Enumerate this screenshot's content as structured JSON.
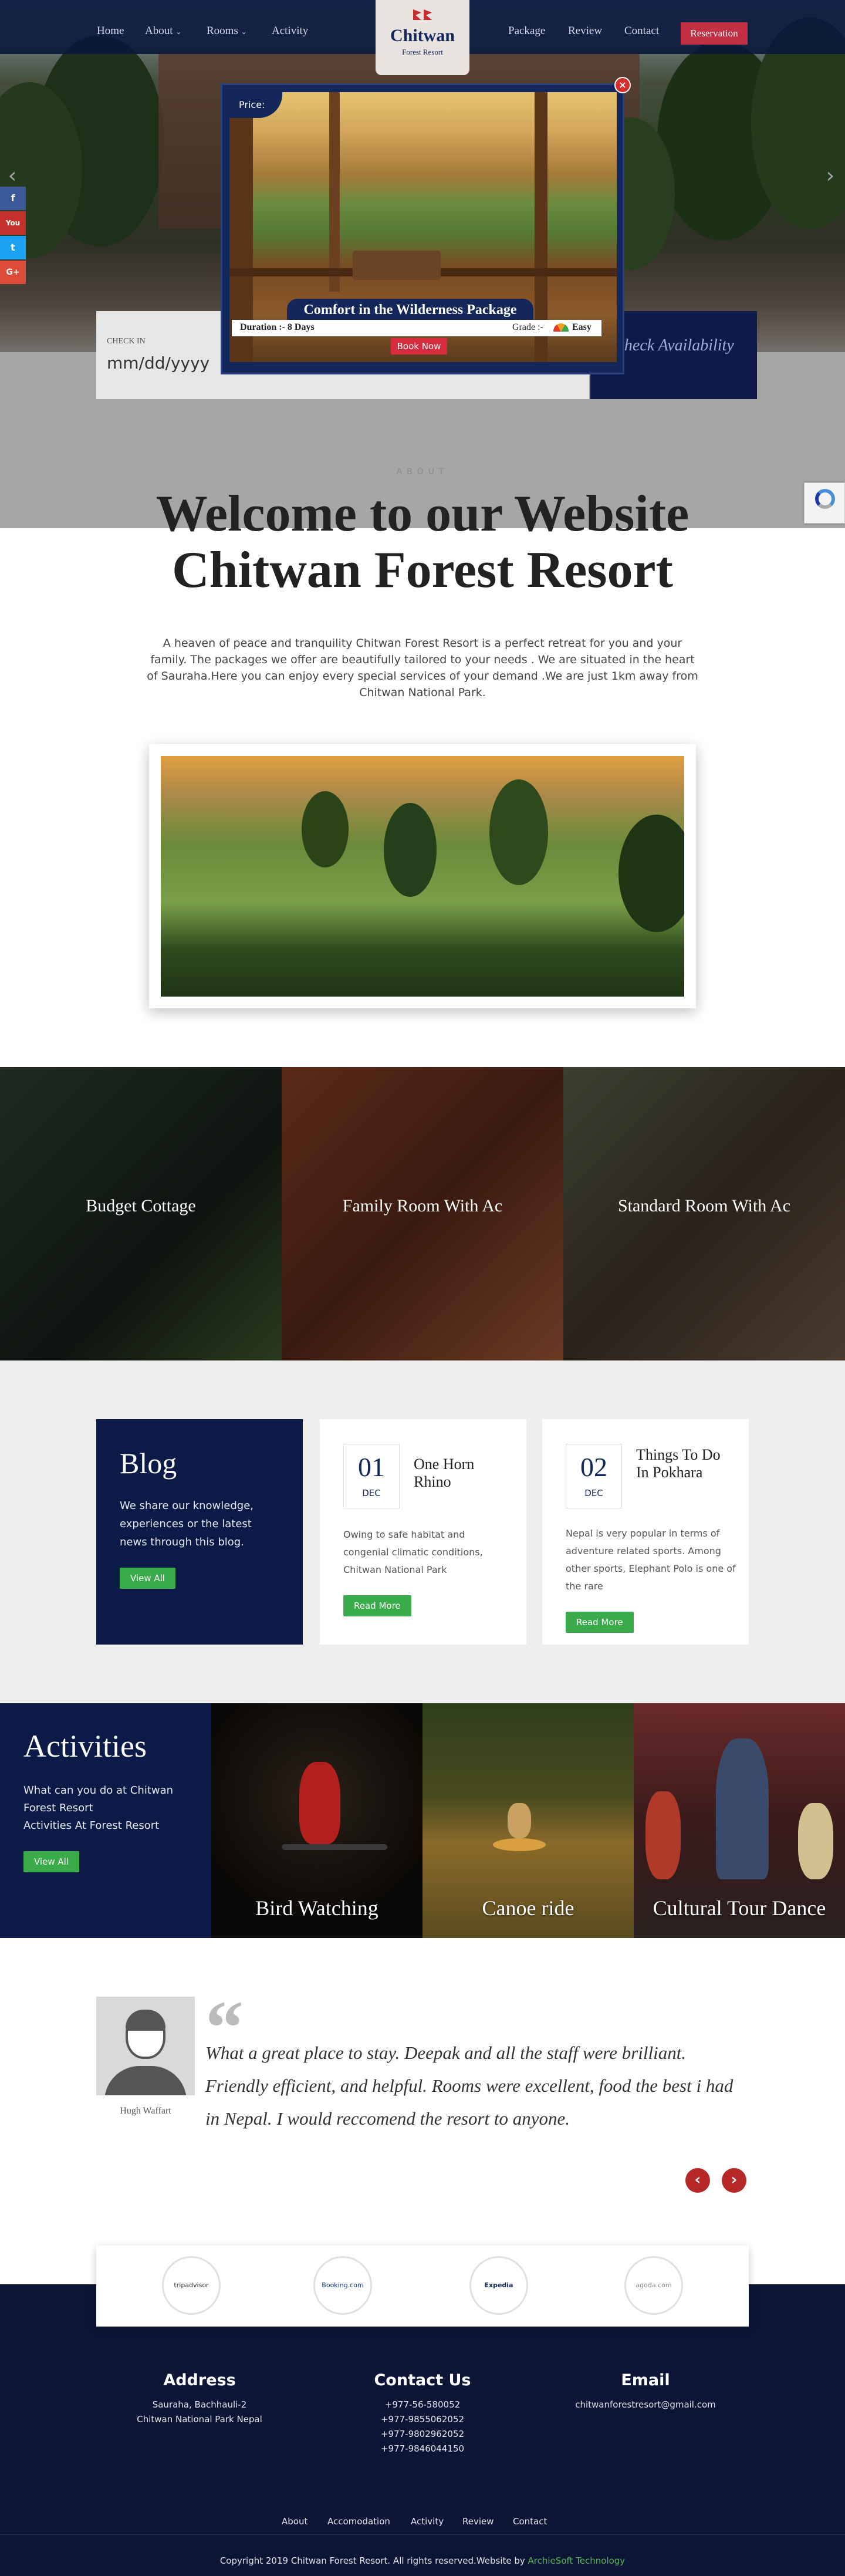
{
  "nav": {
    "left": [
      "Home",
      "About",
      "Rooms",
      "Activity"
    ],
    "right": [
      "Package",
      "Review",
      "Contact"
    ],
    "reservation": "Reservation"
  },
  "logo": {
    "title": "Chitwan",
    "subtitle": "Forest Resort"
  },
  "booking": {
    "check_in_label": "CHECK IN",
    "check_in_value": "mm/dd/yyyy",
    "check_button": "Check Availability"
  },
  "popup": {
    "price_label": "Price:",
    "title": "Comfort in the Wilderness Package",
    "duration": "Duration :- 8 Days",
    "grade": "Grade :-",
    "grade_value": "Easy",
    "book": "Book Now",
    "close": "×"
  },
  "about": {
    "kicker": "ABOUT",
    "title_line1": "Welcome to our Website",
    "title_line2": "Chitwan Forest Resort",
    "text": "A heaven of peace and tranquility Chitwan Forest Resort is a perfect retreat for you and your family. The packages we offer are beautifully tailored to your needs . We are situated in the heart of Sauraha.Here you can enjoy every special services of your demand .We are just 1km away from Chitwan National Park."
  },
  "rooms": [
    "Budget Cottage",
    "Family Room With Ac",
    "Standard Room With Ac"
  ],
  "blog": {
    "title": "Blog",
    "text": "We share our knowledge, experiences or the latest news through this blog.",
    "view_all": "View All",
    "cards": [
      {
        "day": "01",
        "month": "DEC",
        "title": "One Horn Rhino",
        "text": "Owing to safe habitat and congenial climatic conditions, Chitwan National Park",
        "button": "Read More"
      },
      {
        "day": "02",
        "month": "DEC",
        "title": "Things To Do In Pokhara",
        "text": "Nepal is very popular in terms of adventure related sports. Among other sports, Elephant Polo is one of the rare",
        "button": "Read More"
      }
    ]
  },
  "activities": {
    "title": "Activities",
    "line1": "What can you do at Chitwan Forest Resort",
    "line2": "Activities At Forest Resort",
    "view_all": "View All",
    "items": [
      "Bird Watching",
      "Canoe ride",
      "Cultural Tour Dance"
    ]
  },
  "testimonial": {
    "name": "Hugh Waffart",
    "quote": "What a great place to stay. Deepak and all the staff were brilliant. Friendly efficient, and helpful. Rooms were excellent, food the best i had in Nepal. I would reccomend the resort to anyone.",
    "prev": "‹",
    "next": "›"
  },
  "partners": [
    "tripadvisor",
    "Booking.com",
    "Expedia",
    "agoda.com"
  ],
  "footer": {
    "address_title": "Address",
    "address_lines": [
      "Sauraha, Bachhauli-2",
      "Chitwan National Park Nepal"
    ],
    "contact_title": "Contact Us",
    "phones": [
      "+977-56-580052",
      "+977-9855062052",
      "+977-9802962052",
      "+977-9846044150"
    ],
    "email_title": "Email",
    "email": "chitwanforestresort@gmail.com",
    "links": [
      "About",
      "Accomodation",
      "Activity",
      "Review",
      "Contact"
    ],
    "copyright": "Copyright 2019 Chitwan Forest Resort. All rights reserved.Website by",
    "credit": "ArchieSoft Technology"
  },
  "social": [
    "f",
    "You",
    "t",
    "G+"
  ],
  "colors": {
    "navy": "#0c1a48",
    "accent_red": "#c33044",
    "green": "#3aab4a"
  }
}
